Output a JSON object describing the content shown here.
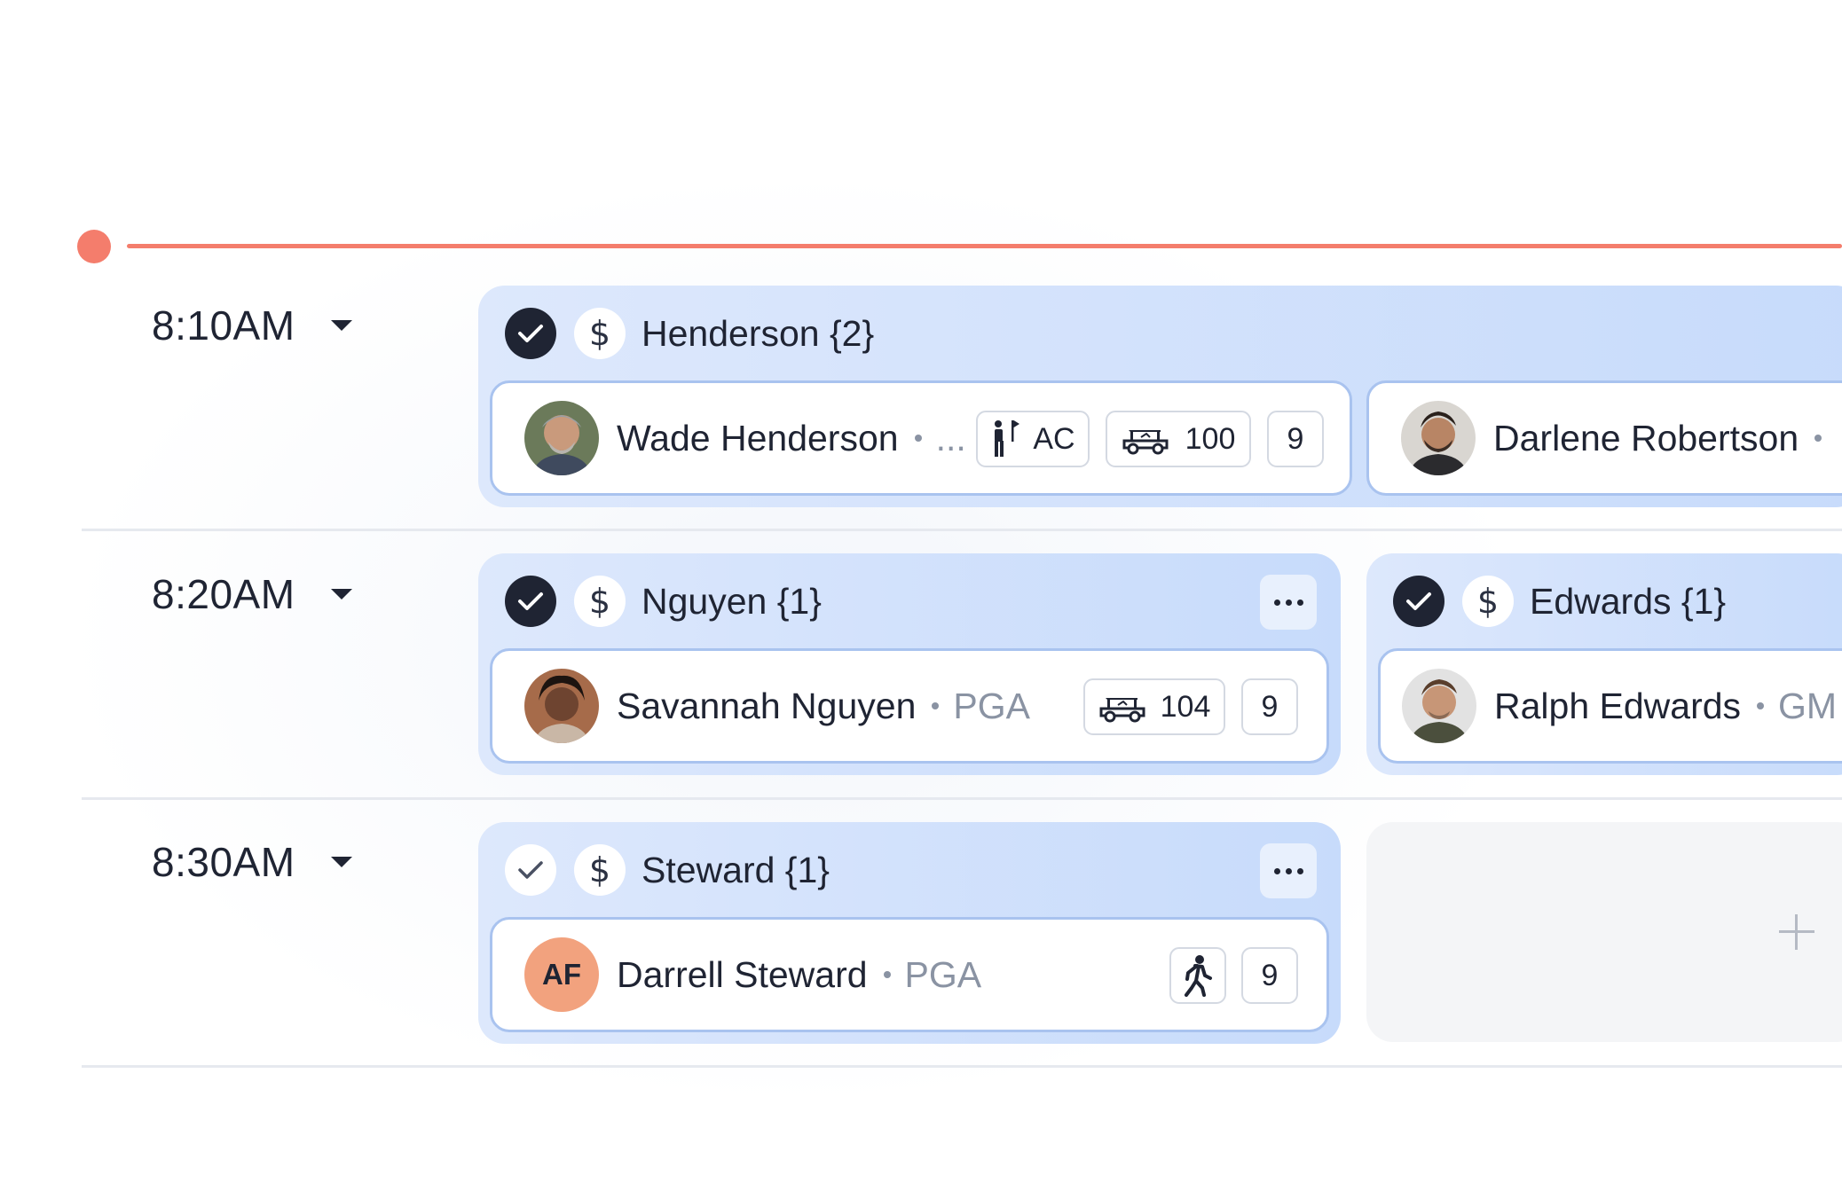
{
  "colors": {
    "now_indicator": "#f47d6c",
    "group_bg": "#d4e3fc",
    "player_border": "#a9c3ef",
    "text_primary": "#1f2433",
    "text_secondary": "#8a93a3",
    "avatar_initials_bg": "#f2a27e"
  },
  "rows": [
    {
      "time": "8:10AM",
      "groups": [
        {
          "checked": true,
          "title": "Henderson {2}",
          "players": [
            {
              "name": "Wade Henderson",
              "role": "...",
              "chips": [
                {
                  "icon": "golfer-flag-icon",
                  "text": "AC"
                },
                {
                  "icon": "golf-cart-icon",
                  "text": "100"
                },
                {
                  "icon": "",
                  "text": "9"
                }
              ]
            },
            {
              "name": "Darlene Robertson",
              "role": ""
            }
          ]
        }
      ]
    },
    {
      "time": "8:20AM",
      "groups": [
        {
          "checked": true,
          "title": "Nguyen {1}",
          "players": [
            {
              "name": "Savannah Nguyen",
              "role": "PGA",
              "chips": [
                {
                  "icon": "golf-cart-icon",
                  "text": "104"
                },
                {
                  "icon": "",
                  "text": "9"
                }
              ]
            }
          ]
        },
        {
          "checked": true,
          "title": "Edwards {1}",
          "players": [
            {
              "name": "Ralph Edwards",
              "role": "GM"
            }
          ]
        }
      ]
    },
    {
      "time": "8:30AM",
      "groups": [
        {
          "checked": false,
          "title": "Steward {1}",
          "players": [
            {
              "name": "Darrell Steward",
              "role": "PGA",
              "avatar_initials": "AF",
              "chips": [
                {
                  "icon": "walking-icon",
                  "text": ""
                },
                {
                  "icon": "",
                  "text": "9"
                }
              ]
            }
          ]
        }
      ]
    }
  ]
}
